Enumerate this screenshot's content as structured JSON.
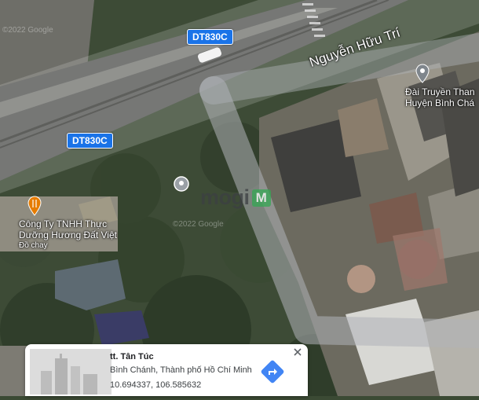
{
  "map": {
    "copyright_top": "©2022 Google",
    "copyright_mid": "©2022 Google",
    "road_shields": [
      "DT830C",
      "DT830C"
    ],
    "street_name": "Nguyễn Hữu Trí",
    "pois": [
      {
        "name_line1": "Đài Truyền Than",
        "name_line2": "Huyện Bình Chá",
        "icon": "pin-icon"
      },
      {
        "name_line1": "Công Ty TNHH Thực",
        "name_line2": "Dưỡng Hương Đất Việt",
        "subtitle": "Đồ chay",
        "icon": "restaurant-icon"
      }
    ],
    "selected_marker_icon": "place-marker-icon",
    "watermark": {
      "text": "mogi",
      "mark": "M"
    }
  },
  "card": {
    "title": "tt. Tân Túc",
    "address": "Bình Chánh, Thành phố Hồ Chí Minh",
    "coords": "10.694337, 106.585632",
    "close_icon": "close-icon",
    "directions_icon": "directions-icon"
  },
  "colors": {
    "shield": "#1a73e8",
    "directions": "#4285f4",
    "road_overlay": "#9aa0a6"
  }
}
